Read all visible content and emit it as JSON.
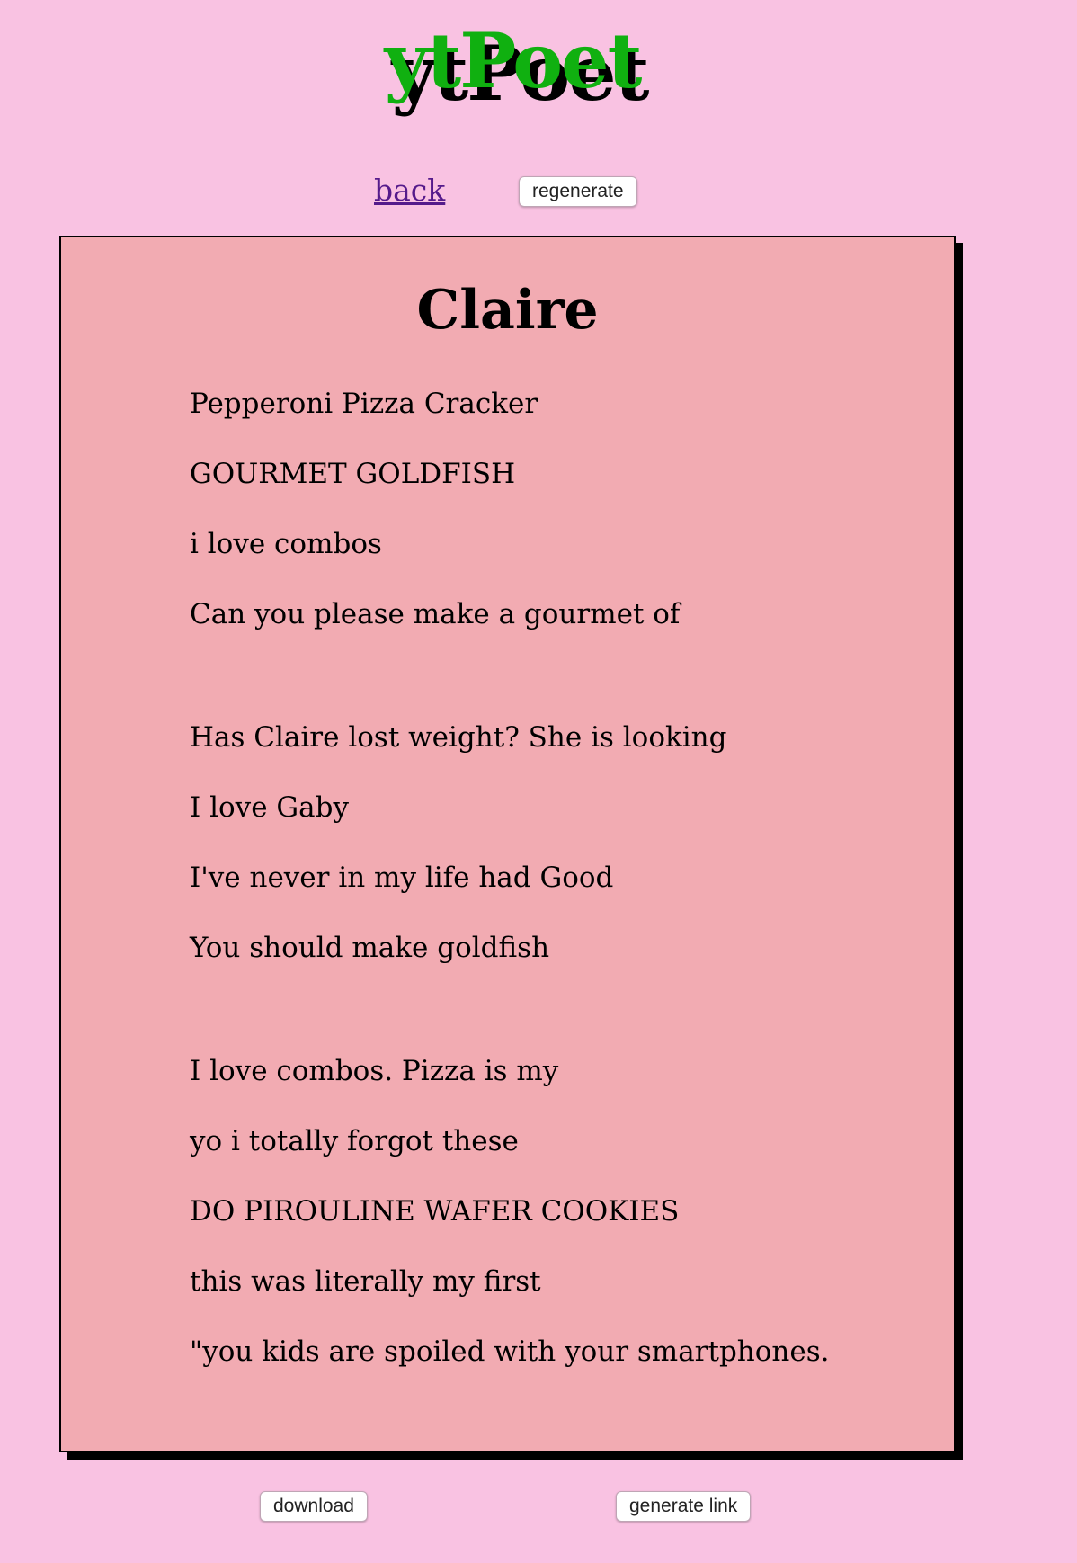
{
  "app": {
    "title": "ytPoet"
  },
  "nav": {
    "back_label": "back",
    "regenerate_label": "regenerate"
  },
  "poem": {
    "title": "Claire",
    "stanzas": [
      [
        "Pepperoni Pizza Cracker",
        "GOURMET GOLDFISH",
        "i love combos",
        "Can you please make a gourmet of"
      ],
      [
        "Has Claire lost weight? She is looking",
        "I love Gaby",
        "I've never in my life had Good",
        "You should make goldfish"
      ],
      [
        "I love combos. Pizza is my",
        "yo i totally forgot these",
        "DO PIROULINE WAFER COOKIES",
        "this was literally my first",
        "\"you kids are spoiled with your smartphones."
      ]
    ]
  },
  "footer": {
    "download_label": "download",
    "generate_link_label": "generate link"
  },
  "colors": {
    "background": "#f9c2e2",
    "card": "#f2abb2",
    "logo": "#10b010",
    "link": "#551a8b"
  }
}
